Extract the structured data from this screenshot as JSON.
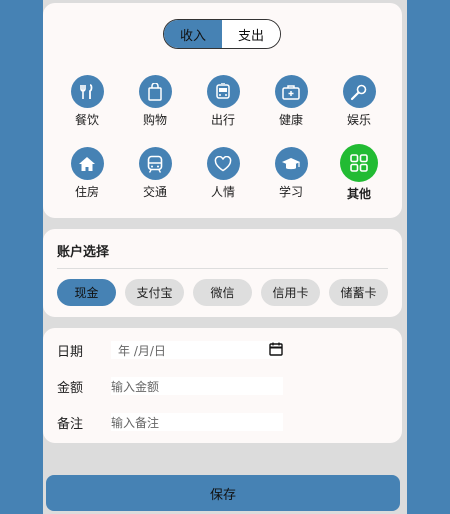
{
  "toggle": {
    "income": "收入",
    "expense": "支出"
  },
  "categories": [
    {
      "label": "餐饮",
      "icon": "fork-knife-icon"
    },
    {
      "label": "购物",
      "icon": "shopping-bag-icon"
    },
    {
      "label": "出行",
      "icon": "bus-front-icon"
    },
    {
      "label": "健康",
      "icon": "medical-kit-icon"
    },
    {
      "label": "娱乐",
      "icon": "microphone-icon"
    },
    {
      "label": "住房",
      "icon": "house-icon"
    },
    {
      "label": "交通",
      "icon": "subway-icon"
    },
    {
      "label": "人情",
      "icon": "heart-icon"
    },
    {
      "label": "学习",
      "icon": "graduation-cap-icon"
    },
    {
      "label": "其他",
      "icon": "grid-icon"
    }
  ],
  "accounts": {
    "title": "账户选择",
    "items": [
      "现金",
      "支付宝",
      "微信",
      "信用卡",
      "储蓄卡"
    ],
    "selected": "现金"
  },
  "form": {
    "date_label": "日期",
    "date_placeholder": "年 /月/日",
    "amount_label": "金额",
    "amount_placeholder": "输入金额",
    "note_label": "备注",
    "note_placeholder": "输入备注"
  },
  "save_label": "保存",
  "colors": {
    "accent": "#4682b4",
    "other_accent": "#22bb33",
    "background": "#dcdcdc"
  }
}
